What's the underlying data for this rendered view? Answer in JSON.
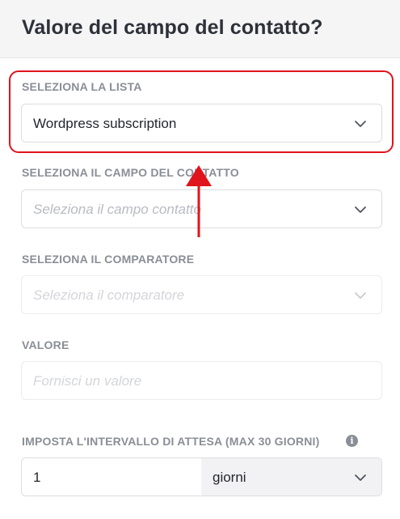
{
  "header": {
    "title": "Valore del campo del contatto?"
  },
  "list_select": {
    "label": "SELEZIONA LA LISTA",
    "value": "Wordpress subscription"
  },
  "contact_field_select": {
    "label": "SELEZIONA IL CAMPO DEL CONTATTO",
    "placeholder": "Seleziona il campo contatto"
  },
  "comparator_select": {
    "label": "SELEZIONA IL COMPARATORE",
    "placeholder": "Seleziona il comparatore"
  },
  "value_input": {
    "label": "VALORE",
    "placeholder": "Fornisci un valore"
  },
  "wait_interval": {
    "label": "IMPOSTA L'INTERVALLO DI ATTESA (MAX 30 GIORNI)",
    "amount": "1",
    "unit": "giorni",
    "info_icon": "info-icon"
  },
  "annotation": {
    "highlight_color": "#e0141c",
    "arrow_color": "#e0141c"
  }
}
